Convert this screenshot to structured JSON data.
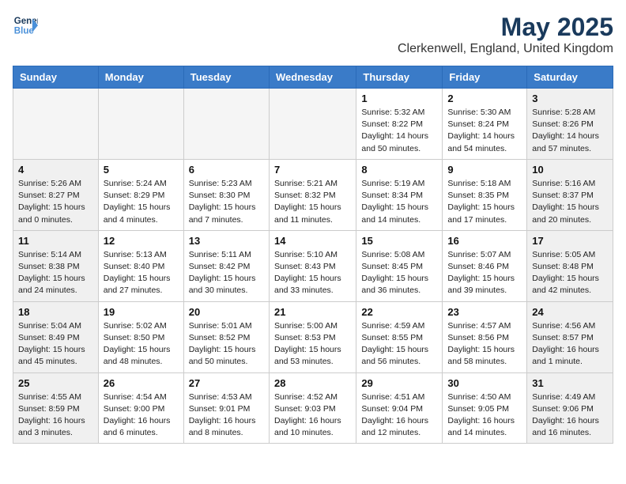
{
  "header": {
    "logo_line1": "General",
    "logo_line2": "Blue",
    "month_title": "May 2025",
    "location": "Clerkenwell, England, United Kingdom"
  },
  "weekdays": [
    "Sunday",
    "Monday",
    "Tuesday",
    "Wednesday",
    "Thursday",
    "Friday",
    "Saturday"
  ],
  "weeks": [
    [
      {
        "day": "",
        "empty": true
      },
      {
        "day": "",
        "empty": true
      },
      {
        "day": "",
        "empty": true
      },
      {
        "day": "",
        "empty": true
      },
      {
        "day": "1",
        "sunrise": "5:32 AM",
        "sunset": "8:22 PM",
        "daylight": "14 hours and 50 minutes."
      },
      {
        "day": "2",
        "sunrise": "5:30 AM",
        "sunset": "8:24 PM",
        "daylight": "14 hours and 54 minutes."
      },
      {
        "day": "3",
        "sunrise": "5:28 AM",
        "sunset": "8:26 PM",
        "daylight": "14 hours and 57 minutes."
      }
    ],
    [
      {
        "day": "4",
        "sunrise": "5:26 AM",
        "sunset": "8:27 PM",
        "daylight": "15 hours and 0 minutes."
      },
      {
        "day": "5",
        "sunrise": "5:24 AM",
        "sunset": "8:29 PM",
        "daylight": "15 hours and 4 minutes."
      },
      {
        "day": "6",
        "sunrise": "5:23 AM",
        "sunset": "8:30 PM",
        "daylight": "15 hours and 7 minutes."
      },
      {
        "day": "7",
        "sunrise": "5:21 AM",
        "sunset": "8:32 PM",
        "daylight": "15 hours and 11 minutes."
      },
      {
        "day": "8",
        "sunrise": "5:19 AM",
        "sunset": "8:34 PM",
        "daylight": "15 hours and 14 minutes."
      },
      {
        "day": "9",
        "sunrise": "5:18 AM",
        "sunset": "8:35 PM",
        "daylight": "15 hours and 17 minutes."
      },
      {
        "day": "10",
        "sunrise": "5:16 AM",
        "sunset": "8:37 PM",
        "daylight": "15 hours and 20 minutes."
      }
    ],
    [
      {
        "day": "11",
        "sunrise": "5:14 AM",
        "sunset": "8:38 PM",
        "daylight": "15 hours and 24 minutes."
      },
      {
        "day": "12",
        "sunrise": "5:13 AM",
        "sunset": "8:40 PM",
        "daylight": "15 hours and 27 minutes."
      },
      {
        "day": "13",
        "sunrise": "5:11 AM",
        "sunset": "8:42 PM",
        "daylight": "15 hours and 30 minutes."
      },
      {
        "day": "14",
        "sunrise": "5:10 AM",
        "sunset": "8:43 PM",
        "daylight": "15 hours and 33 minutes."
      },
      {
        "day": "15",
        "sunrise": "5:08 AM",
        "sunset": "8:45 PM",
        "daylight": "15 hours and 36 minutes."
      },
      {
        "day": "16",
        "sunrise": "5:07 AM",
        "sunset": "8:46 PM",
        "daylight": "15 hours and 39 minutes."
      },
      {
        "day": "17",
        "sunrise": "5:05 AM",
        "sunset": "8:48 PM",
        "daylight": "15 hours and 42 minutes."
      }
    ],
    [
      {
        "day": "18",
        "sunrise": "5:04 AM",
        "sunset": "8:49 PM",
        "daylight": "15 hours and 45 minutes."
      },
      {
        "day": "19",
        "sunrise": "5:02 AM",
        "sunset": "8:50 PM",
        "daylight": "15 hours and 48 minutes."
      },
      {
        "day": "20",
        "sunrise": "5:01 AM",
        "sunset": "8:52 PM",
        "daylight": "15 hours and 50 minutes."
      },
      {
        "day": "21",
        "sunrise": "5:00 AM",
        "sunset": "8:53 PM",
        "daylight": "15 hours and 53 minutes."
      },
      {
        "day": "22",
        "sunrise": "4:59 AM",
        "sunset": "8:55 PM",
        "daylight": "15 hours and 56 minutes."
      },
      {
        "day": "23",
        "sunrise": "4:57 AM",
        "sunset": "8:56 PM",
        "daylight": "15 hours and 58 minutes."
      },
      {
        "day": "24",
        "sunrise": "4:56 AM",
        "sunset": "8:57 PM",
        "daylight": "16 hours and 1 minute."
      }
    ],
    [
      {
        "day": "25",
        "sunrise": "4:55 AM",
        "sunset": "8:59 PM",
        "daylight": "16 hours and 3 minutes."
      },
      {
        "day": "26",
        "sunrise": "4:54 AM",
        "sunset": "9:00 PM",
        "daylight": "16 hours and 6 minutes."
      },
      {
        "day": "27",
        "sunrise": "4:53 AM",
        "sunset": "9:01 PM",
        "daylight": "16 hours and 8 minutes."
      },
      {
        "day": "28",
        "sunrise": "4:52 AM",
        "sunset": "9:03 PM",
        "daylight": "16 hours and 10 minutes."
      },
      {
        "day": "29",
        "sunrise": "4:51 AM",
        "sunset": "9:04 PM",
        "daylight": "16 hours and 12 minutes."
      },
      {
        "day": "30",
        "sunrise": "4:50 AM",
        "sunset": "9:05 PM",
        "daylight": "16 hours and 14 minutes."
      },
      {
        "day": "31",
        "sunrise": "4:49 AM",
        "sunset": "9:06 PM",
        "daylight": "16 hours and 16 minutes."
      }
    ]
  ]
}
